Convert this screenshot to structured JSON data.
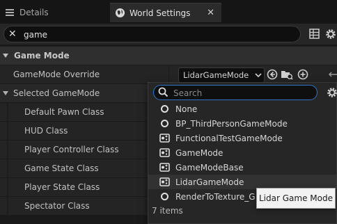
{
  "tabs": [
    {
      "label": "Details",
      "icon": "details-icon"
    },
    {
      "label": "World Settings",
      "icon": "globe-icon",
      "close": "✕"
    }
  ],
  "search": {
    "value": "game",
    "clear_icon": "close-icon"
  },
  "categories": {
    "game_mode": "Game Mode",
    "selected_game_mode": "Selected GameMode"
  },
  "properties": {
    "gamemode_override": "GameMode Override",
    "gamemode_override_value": "LidarGameMode",
    "rows": [
      "Default Pawn Class",
      "HUD Class",
      "Player Controller Class",
      "Game State Class",
      "Player State Class",
      "Spectator Class"
    ]
  },
  "dropdown": {
    "search_placeholder": "Search",
    "options": [
      {
        "label": "None",
        "icon": "circle-icon"
      },
      {
        "label": "BP_ThirdPersonGameMode",
        "icon": "circle-icon"
      },
      {
        "label": "FunctionalTestGameMode",
        "icon": "class-icon"
      },
      {
        "label": "GameMode",
        "icon": "class-icon"
      },
      {
        "label": "GameModeBase",
        "icon": "class-icon"
      },
      {
        "label": "LidarGameMode",
        "icon": "class-icon",
        "highlighted": true
      },
      {
        "label": "RenderToTexture_G",
        "icon": "circle-icon"
      }
    ],
    "count": "7 items"
  },
  "tooltip": "Lidar Game Mode",
  "colors": {
    "background": "#1a1a1a",
    "panel": "#242424",
    "accent_blue": "#2f74c6",
    "text": "#c0c0c0"
  }
}
